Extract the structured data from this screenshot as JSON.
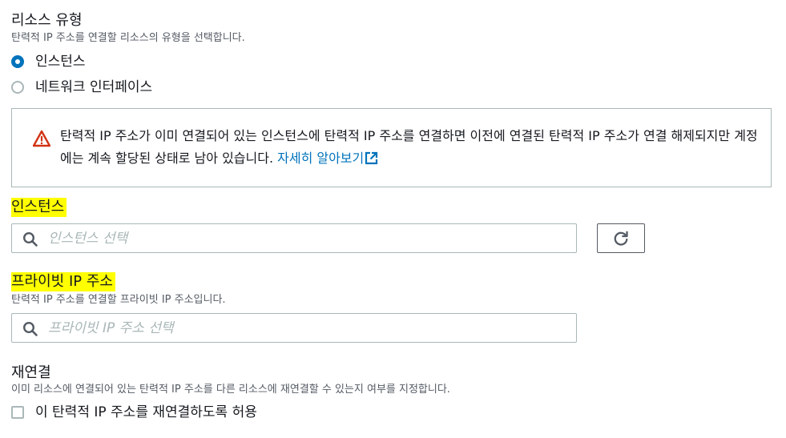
{
  "resource_type": {
    "title": "리소스 유형",
    "description": "탄력적 IP 주소를 연결할 리소스의 유형을 선택합니다.",
    "options": [
      {
        "label": "인스턴스",
        "selected": true
      },
      {
        "label": "네트워크 인터페이스",
        "selected": false
      }
    ]
  },
  "alert": {
    "icon": "warning-triangle-icon",
    "text": "탄력적 IP 주소가 이미 연결되어 있는 인스턴스에 탄력적 IP 주소를 연결하면 이전에 연결된 탄력적 IP 주소가 연결 해제되지만 계정에는 계속 할당된 상태로 남아 있습니다. ",
    "link_label": "자세히 알아보기",
    "link_icon": "external-link-icon"
  },
  "instance": {
    "label": "인스턴스",
    "placeholder": "인스턴스 선택",
    "refresh_icon": "refresh-icon"
  },
  "private_ip": {
    "label": "프라이빗 IP 주소",
    "description": "탄력적 IP 주소를 연결할 프라이빗 IP 주소입니다.",
    "placeholder": "프라이빗 IP 주소 선택"
  },
  "reassociation": {
    "title": "재연결",
    "description": "이미 리소스에 연결되어 있는 탄력적 IP 주소를 다른 리소스에 재연결할 수 있는지 여부를 지정합니다.",
    "checkbox_label": "이 탄력적 IP 주소를 재연결하도록 허용",
    "checked": false
  },
  "colors": {
    "accent": "#0073bb",
    "warning": "#d13212",
    "highlight": "#ffff00",
    "border": "#aab7b8",
    "muted_text": "#545b64"
  }
}
